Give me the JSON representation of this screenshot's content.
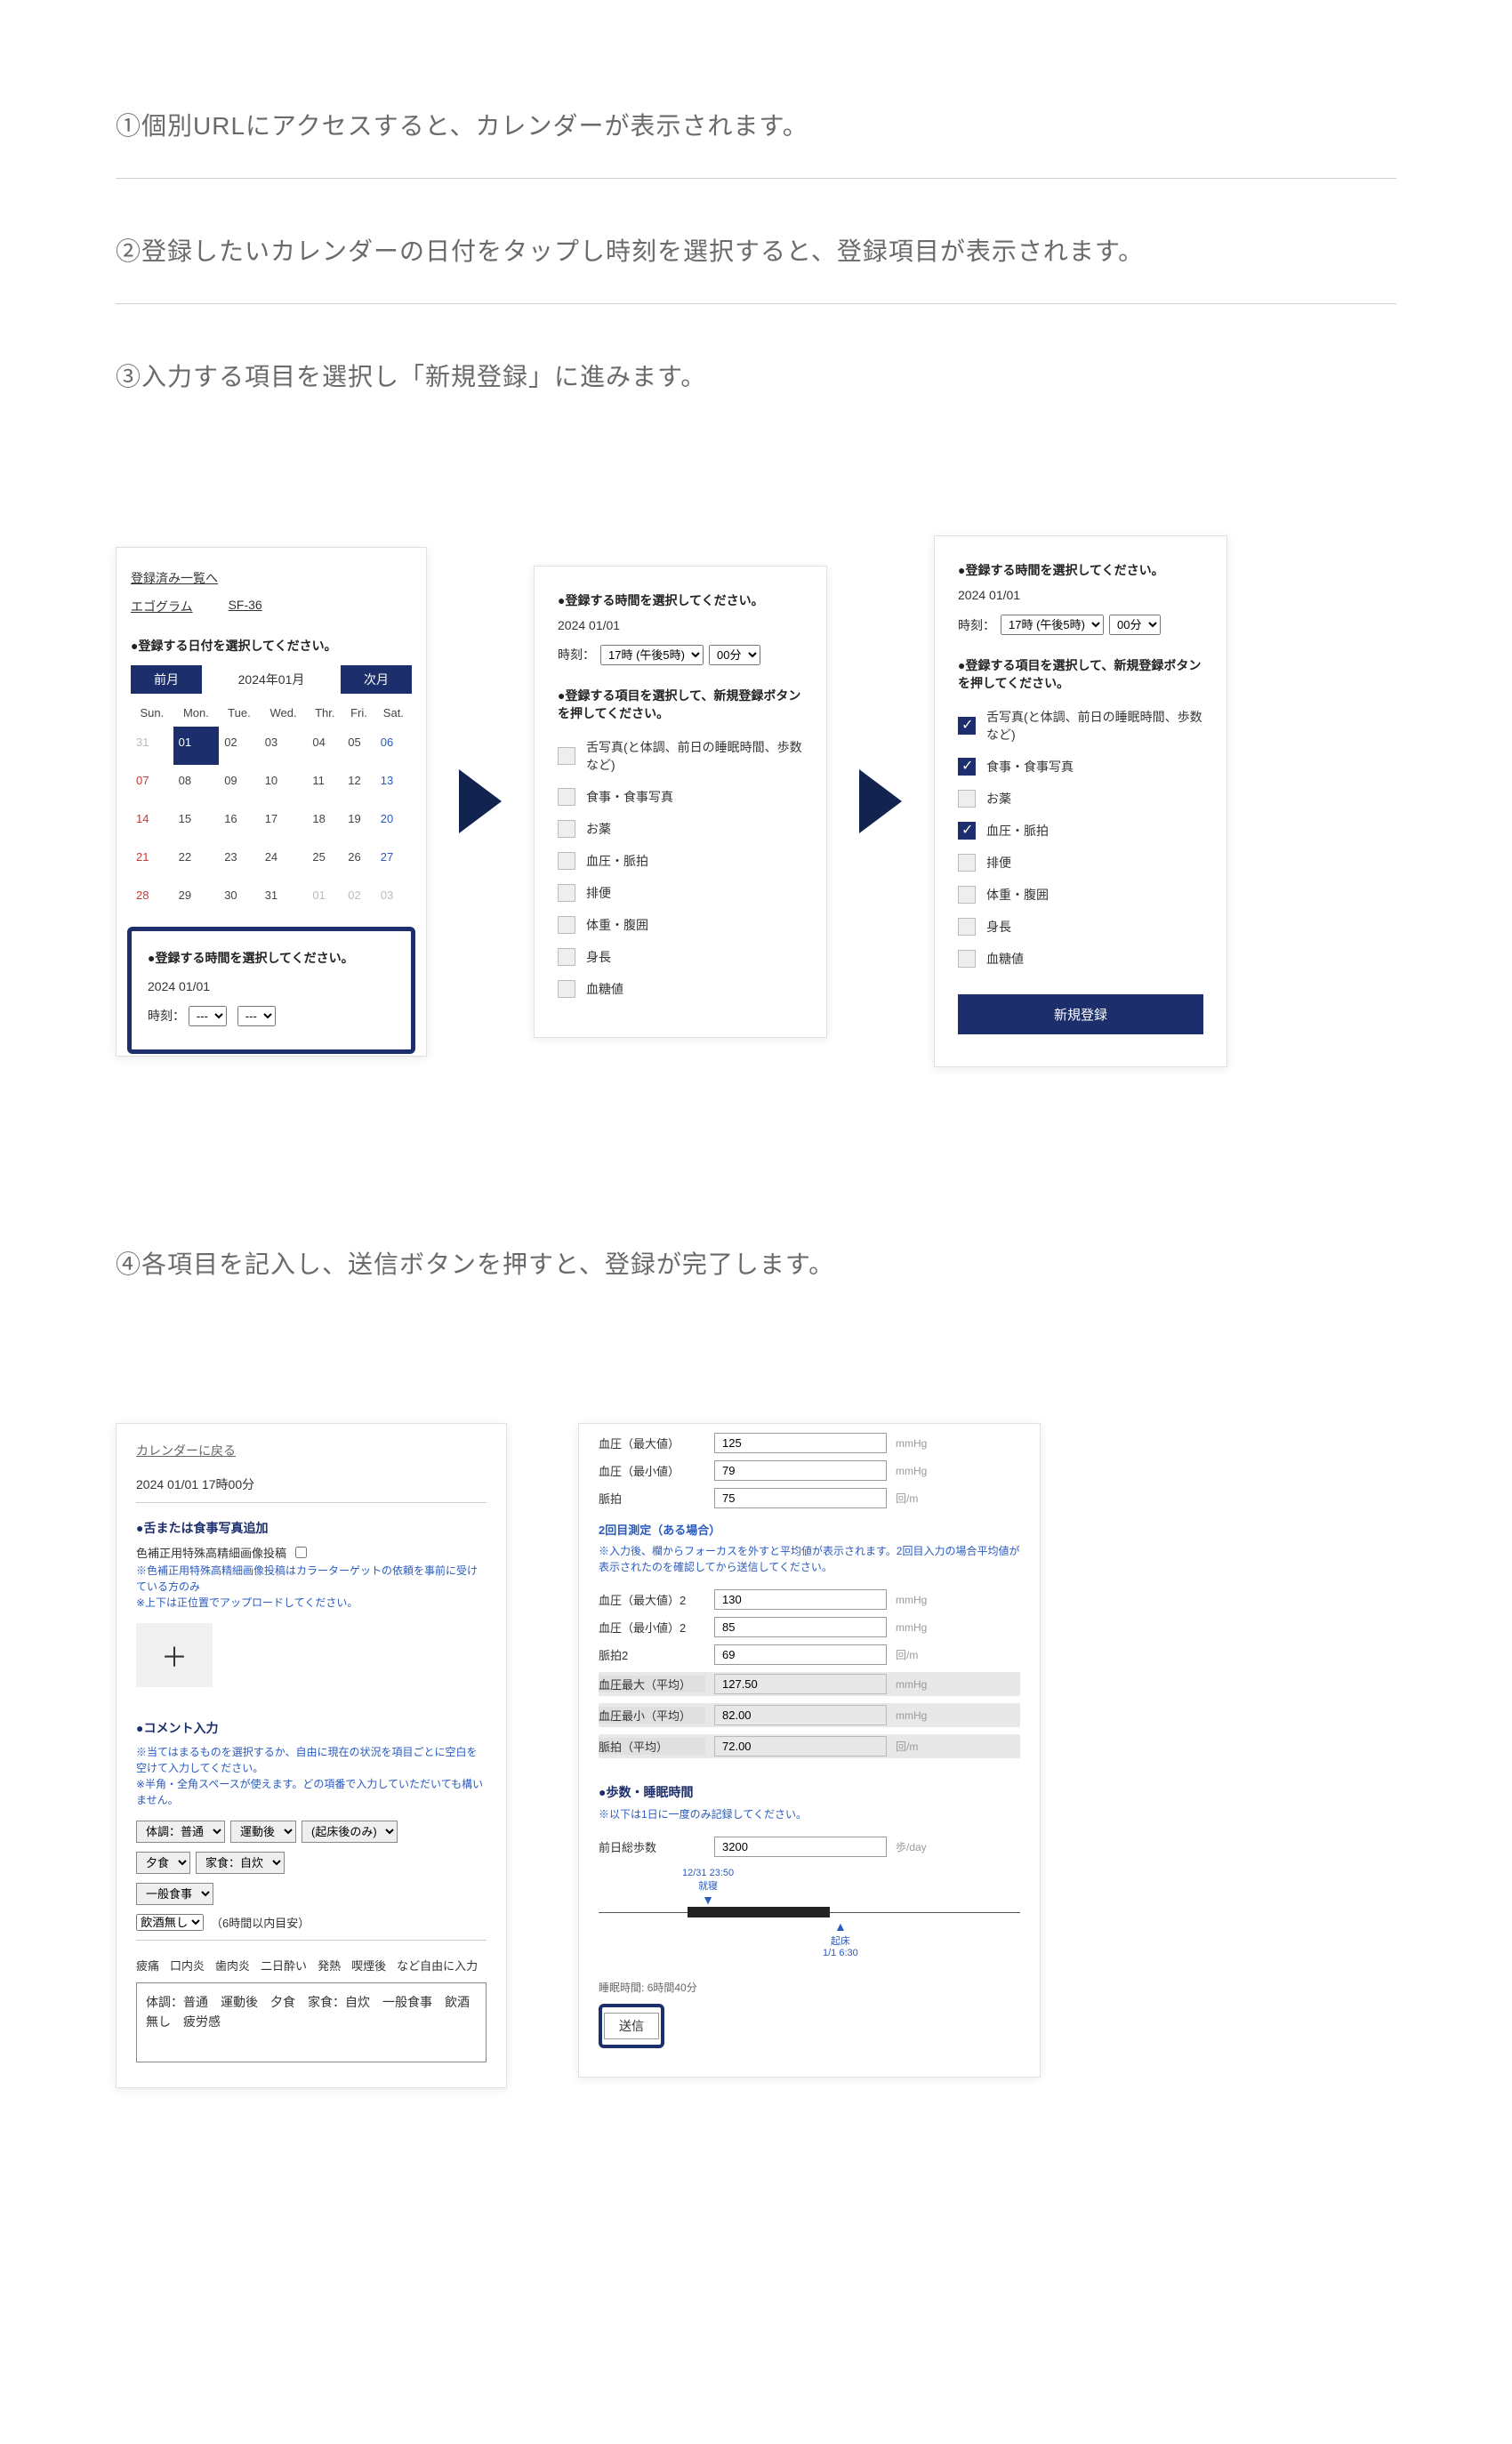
{
  "steps": {
    "s1": "①個別URLにアクセスすると、カレンダーが表示されます。",
    "s2": "②登録したいカレンダーの日付をタップし時刻を選択すると、登録項目が表示されます。",
    "s3": "③入力する項目を選択し「新規登録」に進みます。",
    "s4": "④各項目を記入し、送信ボタンを押すと、登録が完了します。"
  },
  "cal": {
    "back_link": "登録済み一覧へ",
    "tab1": "エゴグラム",
    "tab2": "SF-36",
    "select_date_label": "●登録する日付を選択してください。",
    "prev": "前月",
    "next": "次月",
    "month": "2024年01月",
    "dow": [
      "Sun.",
      "Mon.",
      "Tue.",
      "Wed.",
      "Thr.",
      "Fri.",
      "Sat."
    ],
    "select_time_label": "●登録する時間を選択してください。",
    "date": "2024 01/01",
    "time_label": "時刻：",
    "hour_blank": "---",
    "min_blank": "---"
  },
  "items_common": {
    "time_label": "●登録する時間を選択してください。",
    "date": "2024 01/01",
    "select_items_label": "●登録する項目を選択して、新規登録ボタンを押してください。",
    "hour": "17時 (午後5時)",
    "minute": "00分",
    "time_prefix": "時刻：",
    "list": [
      "舌写真(と体調、前日の睡眠時間、歩数など)",
      "食事・食事写真",
      "お薬",
      "血圧・脈拍",
      "排便",
      "体重・腹囲",
      "身長",
      "血糖値"
    ],
    "register": "新規登録"
  },
  "panel3_checked": [
    true,
    true,
    false,
    true,
    false,
    false,
    false,
    false
  ],
  "form": {
    "back": "カレンダーに戻る",
    "timestamp": "2024 01/01 17時00分",
    "photo_head": "●舌または食事写真追加",
    "photo_note_line1": "色補正用特殊高精細画像投稿",
    "photo_note_line2": "※色補正用特殊高精細画像投稿はカラーターゲットの依頼を事前に受けている方のみ",
    "photo_note_line3": "※上下は正位置でアップロードしてください。",
    "add": "＋",
    "comment_head": "●コメント入力",
    "comment_note1": "※当てはまるものを選択するか、自由に現在の状況を項目ごとに空白を空けて入力してください。",
    "comment_note2": "※半角・全角スペースが使えます。どの項番で入力していただいても構いません。",
    "sel_body": "体調：普通",
    "sel_exercise": "運動後",
    "sel_wake": "(起床後のみ)",
    "sel_dinner": "夕食",
    "sel_home": "家食：自炊",
    "sel_meal": "一般食事",
    "sel_alcohol": "飲酒無し",
    "paren_note": "（6時間以内目安）",
    "tags": [
      "疲痛",
      "口内炎",
      "歯肉炎",
      "二日酔い",
      "発熱",
      "喫煙後",
      "など自由に入力"
    ],
    "textarea": "体調：普通　運動後　夕食　家食：自炊　一般食事　飲酒無し　疲労感"
  },
  "meas": {
    "rows1": [
      {
        "lbl": "血圧（最大値）",
        "val": "125",
        "unit": "mmHg"
      },
      {
        "lbl": "血圧（最小値）",
        "val": "79",
        "unit": "mmHg"
      },
      {
        "lbl": "脈拍",
        "val": "75",
        "unit": "回/m"
      }
    ],
    "second_head": "2回目測定（ある場合）",
    "second_note": "※入力後、欄からフォーカスを外すと平均値が表示されます。2回目入力の場合平均値が表示されたのを確認してから送信してください。",
    "rows2": [
      {
        "lbl": "血圧（最大値）2",
        "val": "130",
        "unit": "mmHg"
      },
      {
        "lbl": "血圧（最小値）2",
        "val": "85",
        "unit": "mmHg"
      },
      {
        "lbl": "脈拍2",
        "val": "69",
        "unit": "回/m"
      }
    ],
    "rows_avg": [
      {
        "lbl": "血圧最大（平均）",
        "val": "127.50",
        "unit": "mmHg"
      },
      {
        "lbl": "血圧最小（平均）",
        "val": "82.00",
        "unit": "mmHg"
      },
      {
        "lbl": "脈拍（平均）",
        "val": "72.00",
        "unit": "回/m"
      }
    ],
    "steps_head": "●歩数・睡眠時間",
    "steps_note": "※以下は1日に一度のみ記録してください。",
    "steps_lbl": "前日総歩数",
    "steps_val": "3200",
    "steps_unit": "歩/day",
    "sleep_start_time": "12/31 23:50",
    "sleep_start_lbl": "就寝",
    "sleep_end_lbl": "起床",
    "sleep_end_time": "1/1 6:30",
    "sleep_dur_lbl": "睡眠時間:",
    "sleep_dur_val": "6時間40分",
    "send": "送信"
  }
}
